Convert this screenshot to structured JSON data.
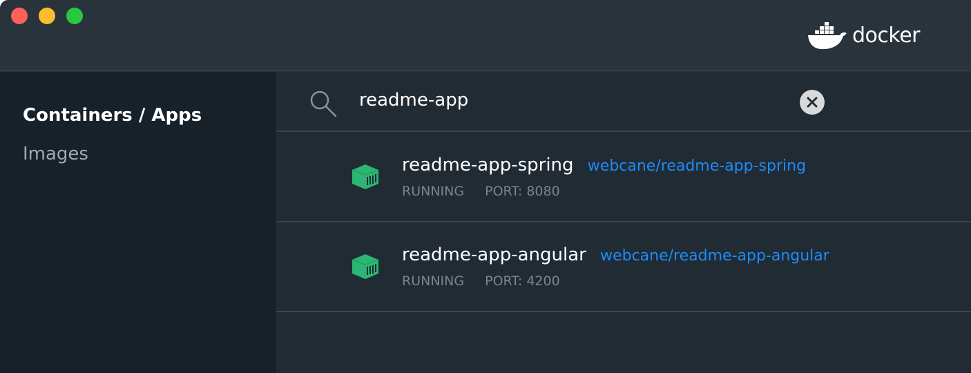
{
  "window": {
    "brand_name": "docker",
    "colors": {
      "background": "#27323b",
      "sidebar": "#17212a",
      "content": "#212b34",
      "link": "#1d8cf8",
      "running": "#2bb673"
    }
  },
  "sidebar": {
    "items": [
      {
        "label": "Containers / Apps",
        "active": true
      },
      {
        "label": "Images",
        "active": false
      }
    ]
  },
  "search": {
    "value": "readme-app",
    "icon": "search-icon",
    "clear_icon": "close-icon"
  },
  "containers": [
    {
      "name": "readme-app-spring",
      "image": "webcane/readme-app-spring",
      "status": "RUNNING",
      "port": "PORT: 8080",
      "icon": "container-icon"
    },
    {
      "name": "readme-app-angular",
      "image": "webcane/readme-app-angular",
      "status": "RUNNING",
      "port": "PORT: 4200",
      "icon": "container-icon"
    }
  ]
}
